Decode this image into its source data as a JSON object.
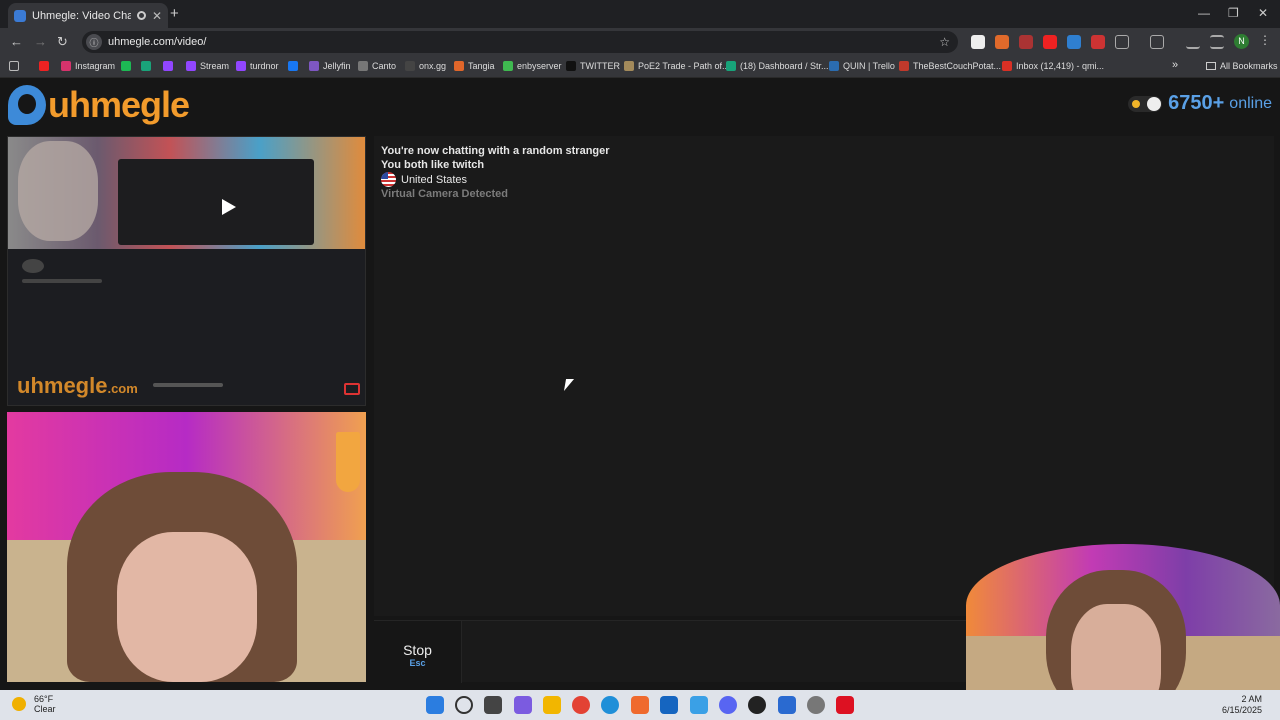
{
  "browser": {
    "tab_title": "Uhmegle: Video Chat | Om",
    "url": "uhmegle.com/video/",
    "profile_initial": "N",
    "all_bookmarks": "All Bookmarks",
    "bookmarks": [
      {
        "label": "Instagram",
        "color": "#d6336c"
      },
      {
        "label": "",
        "color": "#1db954"
      },
      {
        "label": "",
        "color": "#1aa37a"
      },
      {
        "label": "",
        "color": "#9146ff"
      },
      {
        "label": "Stream",
        "color": "#9146ff"
      },
      {
        "label": "turdnor",
        "color": "#9146ff"
      },
      {
        "label": "",
        "color": "#1877f2"
      },
      {
        "label": "Jellyfin",
        "color": "#7e57c2"
      },
      {
        "label": "Canto",
        "color": "#777777"
      },
      {
        "label": "onx.gg",
        "color": "#444444"
      },
      {
        "label": "Tangia",
        "color": "#e0662a"
      },
      {
        "label": "enbyserver",
        "color": "#3fb950"
      },
      {
        "label": "TWITTER",
        "color": "#111111"
      },
      {
        "label": "PoE2 Trade - Path of...",
        "color": "#a38a5b"
      },
      {
        "label": "(18) Dashboard / Str...",
        "color": "#18a37a"
      },
      {
        "label": "QUIN | Trello",
        "color": "#2b6cb0"
      },
      {
        "label": "TheBestCouchPotat...",
        "color": "#c0392b"
      },
      {
        "label": "Inbox (12,419) - qmi...",
        "color": "#d93025"
      }
    ]
  },
  "site": {
    "logo_text": "uhmegle",
    "online_count": "6750+",
    "online_label": "online"
  },
  "stranger_video": {
    "watermark": "uhmegle",
    "watermark_suffix": ".com"
  },
  "chat": {
    "line1": "You're now chatting with a random stranger",
    "line2": "You both like twitch",
    "country": "United States",
    "notice": "Virtual Camera Detected"
  },
  "controls": {
    "stop_label": "Stop",
    "stop_key": "Esc"
  },
  "taskbar": {
    "temperature": "66°F",
    "condition": "Clear",
    "time": "2 AM",
    "date": "6/15/2025"
  }
}
